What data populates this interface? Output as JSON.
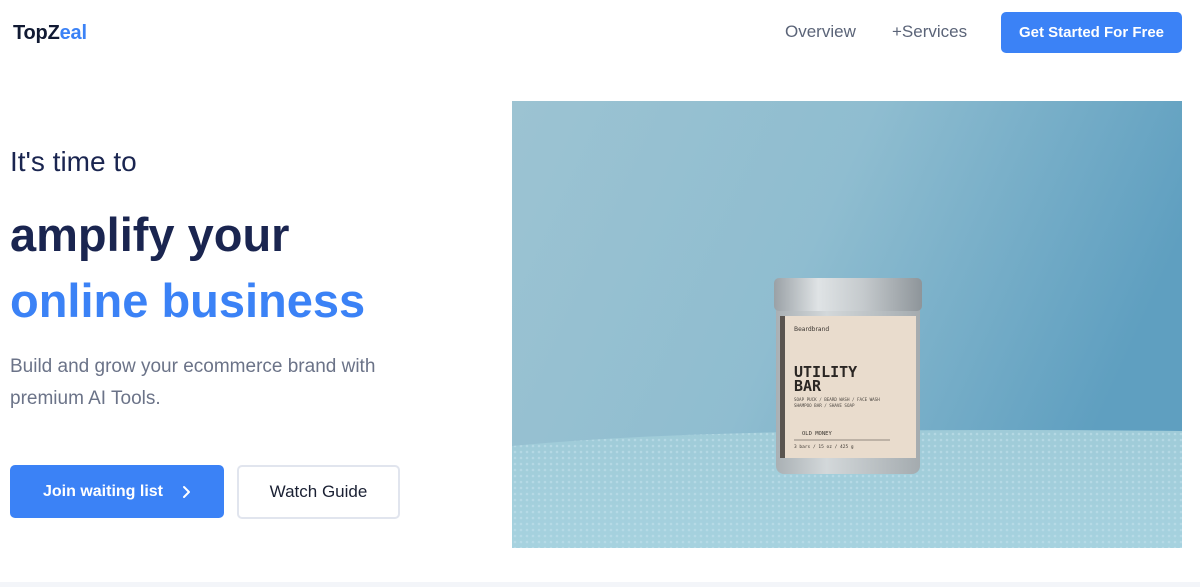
{
  "header": {
    "logo_prefix": "TopZ",
    "logo_accent": "eal",
    "nav": {
      "overview": "Overview",
      "services": "+Services"
    },
    "cta_label": "Get Started For Free"
  },
  "hero": {
    "pre_title": "It's time to",
    "title_line1": "amplify your",
    "title_line2": "online business",
    "subtitle": "Build and grow your ecommerce brand with premium AI Tools.",
    "primary_button": "Join waiting list",
    "secondary_button": "Watch Guide"
  },
  "product_image": {
    "brand": "Beardbrand",
    "name_line1": "UTILITY",
    "name_line2": "BAR",
    "uses_line1": "SOAP PUCK / BEARD WASH / FACE WASH",
    "uses_line2": "SHAMPOO BAR / SHAVE SOAP",
    "scent": "OLD MONEY",
    "size": "3 bars / 15 oz / 425 g"
  },
  "colors": {
    "accent": "#3b82f6",
    "heading": "#1a2550",
    "muted": "#6b7388"
  }
}
